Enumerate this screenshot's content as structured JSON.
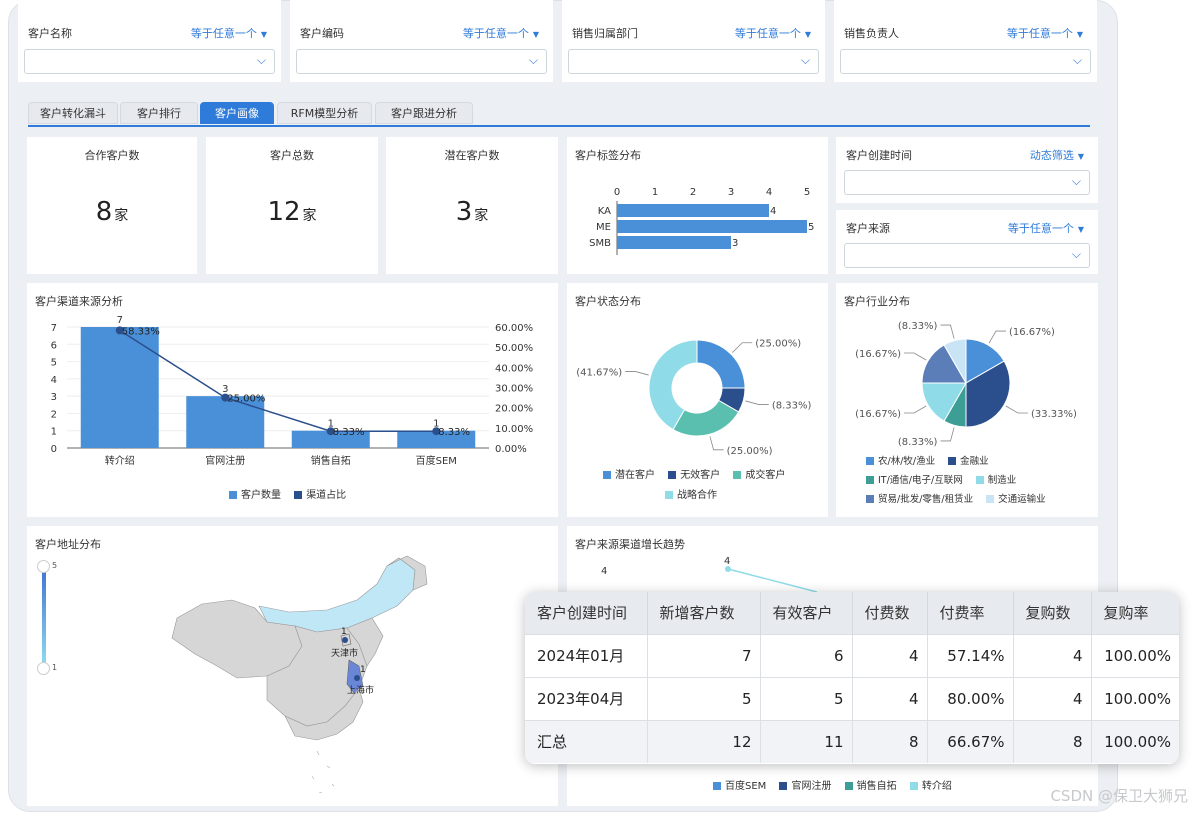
{
  "filters": [
    {
      "label": "客户名称",
      "mode": "等于任意一个"
    },
    {
      "label": "客户编码",
      "mode": "等于任意一个"
    },
    {
      "label": "销售归属部门",
      "mode": "等于任意一个"
    },
    {
      "label": "销售负责人",
      "mode": "等于任意一个"
    }
  ],
  "tabs": [
    "客户转化漏斗",
    "客户排行",
    "客户画像",
    "RFM模型分析",
    "客户跟进分析"
  ],
  "active_tab": "客户画像",
  "kpis": [
    {
      "title": "合作客户数",
      "value": "8",
      "unit": "家"
    },
    {
      "title": "客户总数",
      "value": "12",
      "unit": "家"
    },
    {
      "title": "潜在客户数",
      "value": "3",
      "unit": "家"
    }
  ],
  "side_filters": [
    {
      "label": "客户创建时间",
      "mode": "动态筛选"
    },
    {
      "label": "客户来源",
      "mode": "等于任意一个"
    }
  ],
  "colors": {
    "accent": "#2f7bd9",
    "bar": "#4a90d9",
    "line": "#2b4e8c"
  },
  "chart_data": [
    {
      "type": "bar",
      "title": "客户标签分布",
      "orientation": "horizontal",
      "categories": [
        "KA",
        "ME",
        "SMB"
      ],
      "values": [
        4,
        5,
        3
      ],
      "xlim": [
        0,
        5
      ],
      "ticks": [
        "0",
        "1",
        "2",
        "3",
        "4",
        "5"
      ]
    },
    {
      "type": "bar",
      "title": "客户渠道来源分析",
      "categories": [
        "转介绍",
        "官网注册",
        "销售自拓",
        "百度SEM"
      ],
      "series": [
        {
          "name": "客户数量",
          "values": [
            7,
            3,
            1,
            1
          ],
          "value_labels": [
            "7",
            "3",
            "1",
            "1"
          ]
        },
        {
          "name": "渠道占比",
          "values": [
            58.33,
            25.0,
            8.33,
            8.33
          ],
          "value_labels": [
            "58.33%",
            "25.00%",
            "8.33%",
            "8.33%"
          ]
        }
      ],
      "ylim": [
        0,
        7
      ],
      "y2lim": [
        0,
        60
      ],
      "yticks": [
        "0",
        "1",
        "2",
        "3",
        "4",
        "5",
        "6",
        "7"
      ],
      "y2ticks": [
        "0.00%",
        "10.00%",
        "20.00%",
        "30.00%",
        "40.00%",
        "50.00%",
        "60.00%"
      ]
    },
    {
      "type": "pie",
      "title": "客户状态分布",
      "donut": true,
      "categories": [
        "潜在客户",
        "无效客户",
        "成交客户",
        "战略合作"
      ],
      "values": [
        25.0,
        8.33,
        25.0,
        41.67
      ],
      "value_labels": [
        "(25.00%)",
        "(8.33%)",
        "(25.00%)",
        "(41.67%)"
      ],
      "colors": [
        "#4a90d9",
        "#2b4e8c",
        "#5bbfb0",
        "#8fdce8"
      ]
    },
    {
      "type": "pie",
      "title": "客户行业分布",
      "categories": [
        "农/林/牧/渔业",
        "金融业",
        "IT/通信/电子/互联网",
        "制造业",
        "贸易/批发/零售/租赁业",
        "交通运输业"
      ],
      "values": [
        16.67,
        33.33,
        8.33,
        16.67,
        16.67,
        8.33
      ],
      "value_labels": [
        "(16.67%)",
        "(33.33%)",
        "(8.33%)",
        "(16.67%)",
        "(16.67%)",
        "(8.33%)"
      ],
      "colors": [
        "#4a90d9",
        "#2b4e8c",
        "#3d9e96",
        "#8fdce8",
        "#5b7db8",
        "#c9e4f5"
      ]
    },
    {
      "type": "line",
      "title": "客户来源渠道增长趋势",
      "series_names": [
        "百度SEM",
        "官网注册",
        "销售自拓",
        "转介绍"
      ],
      "visible_labels": [
        "4",
        "4"
      ]
    }
  ],
  "map": {
    "title": "客户地址分布",
    "scale_max": "5",
    "scale_min": "1",
    "labels": [
      "天津市",
      "上海市"
    ],
    "values": [
      "1",
      "1"
    ]
  },
  "table": {
    "headers": [
      "客户创建时间",
      "新增客户数",
      "有效客户",
      "付费数",
      "付费率",
      "复购数",
      "复购率"
    ],
    "rows": [
      [
        "2024年01月",
        "7",
        "6",
        "4",
        "57.14%",
        "4",
        "100.00%"
      ],
      [
        "2023年04月",
        "5",
        "5",
        "4",
        "80.00%",
        "4",
        "100.00%"
      ],
      [
        "汇总",
        "12",
        "11",
        "8",
        "66.67%",
        "8",
        "100.00%"
      ]
    ]
  },
  "watermark": "CSDN @保卫大狮兄"
}
